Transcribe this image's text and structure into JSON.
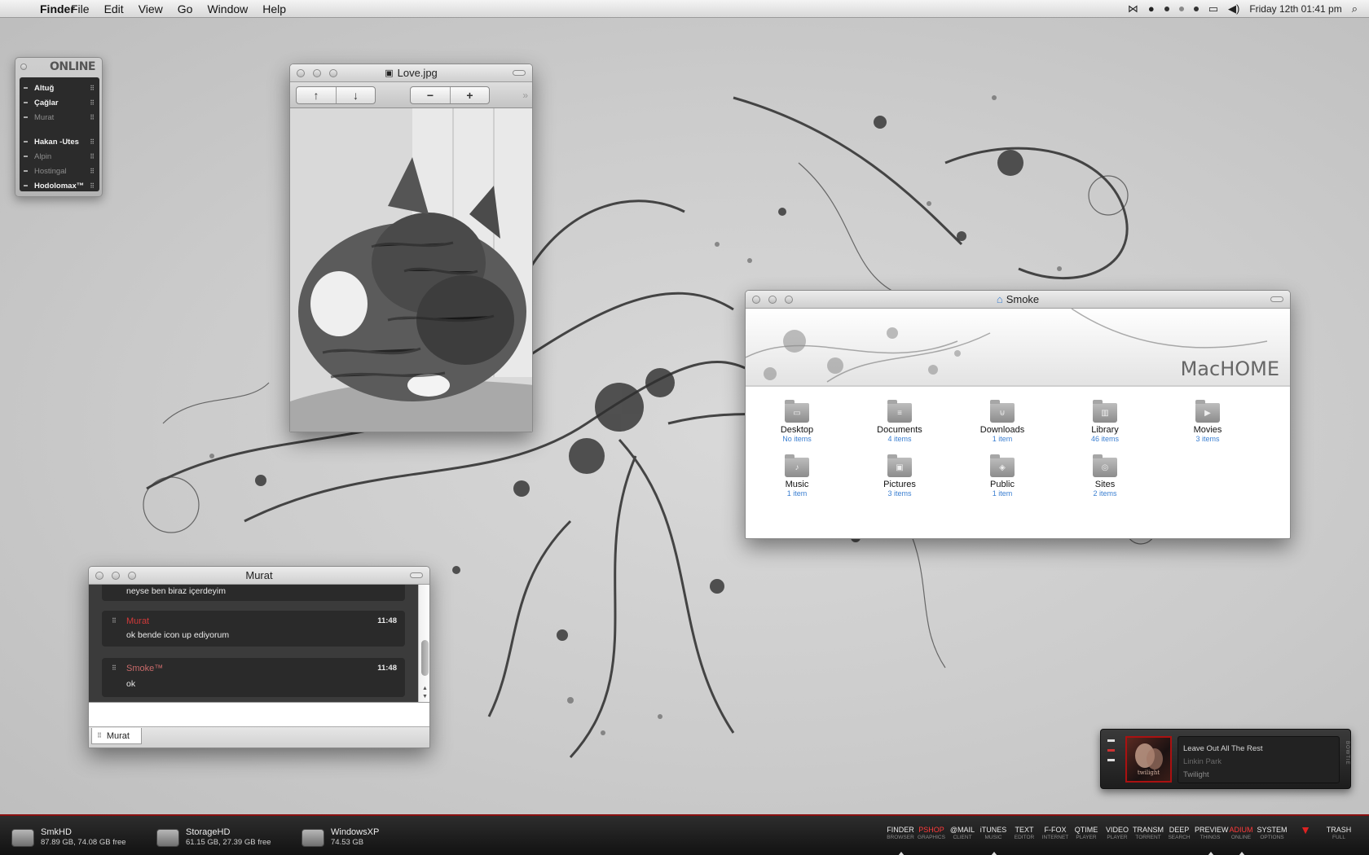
{
  "menubar": {
    "app": "Finder",
    "items": [
      "File",
      "Edit",
      "View",
      "Go",
      "Window",
      "Help"
    ],
    "clock": "Friday 12th  01:41 pm"
  },
  "buddy_list": {
    "title": "ONLINE",
    "buddies": [
      {
        "name": "Altuğ",
        "style": "dim-bold"
      },
      {
        "name": "Çağlar",
        "style": "bright"
      },
      {
        "name": "Murat",
        "style": "dim"
      },
      {
        "name": "Hakan -Utes",
        "style": "bright"
      },
      {
        "name": "Alpin",
        "style": "dim"
      },
      {
        "name": "Hostingal",
        "style": "dim"
      },
      {
        "name": "Hodolomax™",
        "style": "dim-bold"
      }
    ]
  },
  "preview_window": {
    "title": "Love.jpg",
    "toolbar": {
      "prev": "↑",
      "next": "↓",
      "zoom_out": "−",
      "zoom_in": "+"
    }
  },
  "finder_window": {
    "title": "Smoke",
    "brand": "MacHOME",
    "folders": [
      {
        "name": "Desktop",
        "count": "No items",
        "icon": "desktop-glyph"
      },
      {
        "name": "Documents",
        "count": "4 items",
        "icon": "document-glyph"
      },
      {
        "name": "Downloads",
        "count": "1 item",
        "icon": "download-glyph"
      },
      {
        "name": "Library",
        "count": "46 items",
        "icon": "book-glyph"
      },
      {
        "name": "Movies",
        "count": "3 items",
        "icon": "camera-glyph"
      },
      {
        "name": "Music",
        "count": "1 item",
        "icon": "note-glyph"
      },
      {
        "name": "Pictures",
        "count": "3 items",
        "icon": "photo-glyph"
      },
      {
        "name": "Public",
        "count": "1 item",
        "icon": "public-glyph"
      },
      {
        "name": "Sites",
        "count": "2 items",
        "icon": "compass-glyph"
      }
    ]
  },
  "chat_window": {
    "title": "Murat",
    "messages": [
      {
        "sender": "",
        "time": "",
        "text": "neyse ben biraz içerdeyim"
      },
      {
        "sender": "Murat",
        "time": "11:48",
        "text": "ok bende icon up ediyorum"
      },
      {
        "sender": "Smoke™",
        "time": "11:48",
        "text": "ok"
      }
    ],
    "tab": "Murat"
  },
  "now_playing": {
    "track": "Leave Out All The Rest",
    "artist": "Linkin Park",
    "album": "Twilight",
    "art_label": "twilight",
    "side_label": "BOWTIE"
  },
  "drives": [
    {
      "name": "SmkHD",
      "info": "87.89 GB, 74.08 GB free"
    },
    {
      "name": "StorageHD",
      "info": "61.15 GB, 27.39 GB free"
    },
    {
      "name": "WindowsXP",
      "info": "74.53 GB"
    }
  ],
  "dock_apps": [
    {
      "name": "FINDER",
      "sub": "BROWSER",
      "running": true,
      "active": false
    },
    {
      "name": "PSHOP",
      "sub": "GRAPHICS",
      "running": false,
      "active": true
    },
    {
      "name": "@MAIL",
      "sub": "CLIENT",
      "running": false,
      "active": false
    },
    {
      "name": "iTUNES",
      "sub": "MUSIC",
      "running": true,
      "active": false
    },
    {
      "name": "TEXT",
      "sub": "EDITOR",
      "running": false,
      "active": false
    },
    {
      "name": "F-FOX",
      "sub": "INTERNET",
      "running": false,
      "active": false
    },
    {
      "name": "QTIME",
      "sub": "PLAYER",
      "running": false,
      "active": false
    },
    {
      "name": "VIDEO",
      "sub": "PLAYER",
      "running": false,
      "active": false
    },
    {
      "name": "TRANSM",
      "sub": "TORRENT",
      "running": false,
      "active": false
    },
    {
      "name": "DEEP",
      "sub": "SEARCH",
      "running": false,
      "active": false
    },
    {
      "name": "PREVIEW",
      "sub": "THINGS",
      "running": true,
      "active": false
    },
    {
      "name": "ADIUM",
      "sub": "ONLINE",
      "running": true,
      "active": true
    },
    {
      "name": "SYSTEM",
      "sub": "OPTIONS",
      "running": false,
      "active": false
    }
  ],
  "trash": {
    "name": "TRASH",
    "sub": "FULL"
  }
}
